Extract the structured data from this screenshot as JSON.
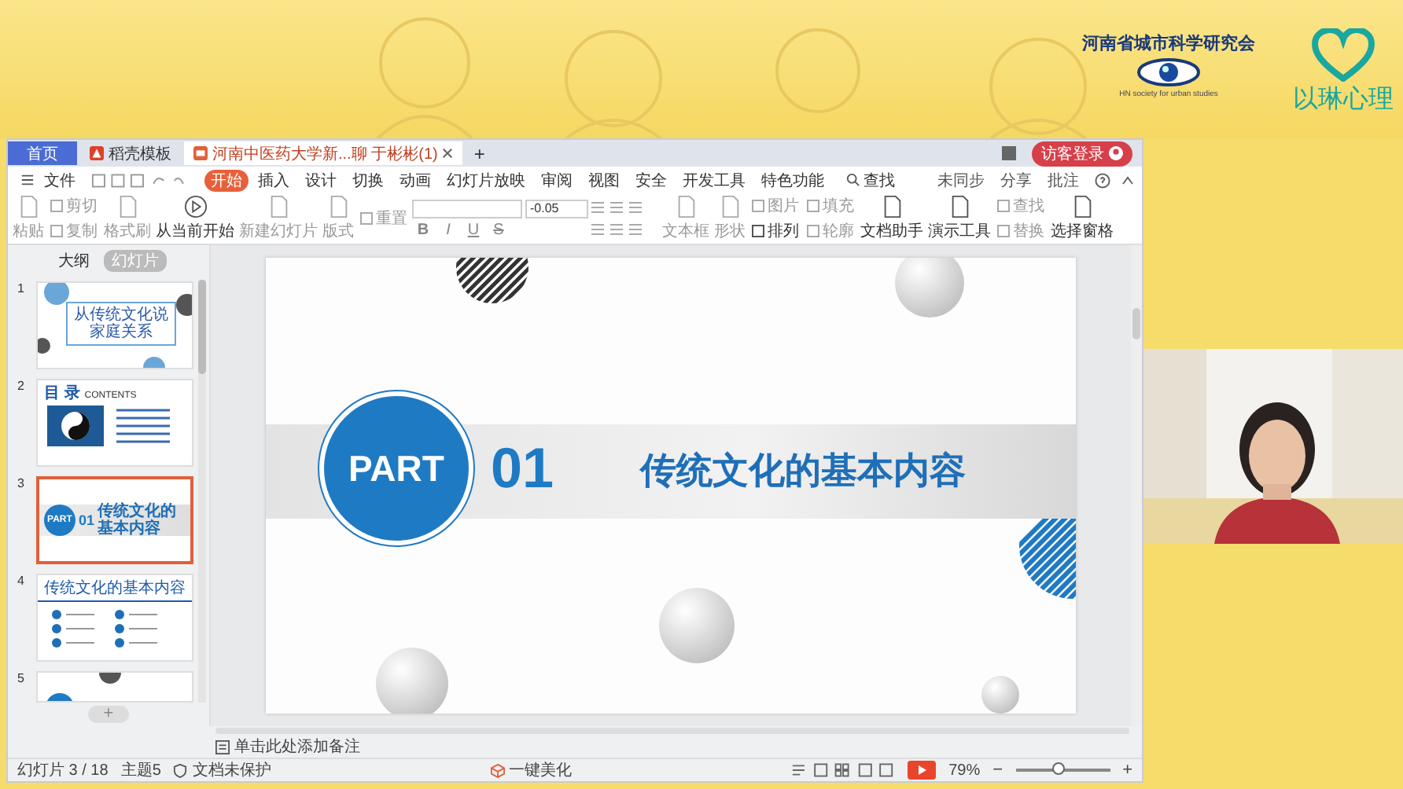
{
  "banner": {
    "org_name": "河南省城市科学研究会",
    "org_subtitle": "HN society for urban studies",
    "brand": "以琳心理"
  },
  "window": {
    "tabs": [
      {
        "label": "首页",
        "kind": "home",
        "selected": false
      },
      {
        "label": "稻壳模板",
        "kind": "template",
        "selected": false
      },
      {
        "label": "河南中医药大学新...聊 于彬彬(1)",
        "kind": "doc",
        "selected": true
      }
    ],
    "new_tab": "+",
    "login_button": "访客登录",
    "file_menu": "文件",
    "menu_tabs": [
      {
        "label": "开始",
        "selected": true
      },
      {
        "label": "插入",
        "selected": false
      },
      {
        "label": "设计",
        "selected": false
      },
      {
        "label": "切换",
        "selected": false
      },
      {
        "label": "动画",
        "selected": false
      },
      {
        "label": "幻灯片放映",
        "selected": false
      },
      {
        "label": "审阅",
        "selected": false
      },
      {
        "label": "视图",
        "selected": false
      },
      {
        "label": "安全",
        "selected": false
      },
      {
        "label": "开发工具",
        "selected": false
      },
      {
        "label": "特色功能",
        "selected": false
      }
    ],
    "search": "查找",
    "right_actions": [
      "未同步",
      "分享",
      "批注"
    ],
    "ribbon": [
      {
        "kind": "large",
        "label": "粘贴",
        "disabled": true
      },
      {
        "kind": "stack",
        "items": [
          {
            "label": "剪切",
            "disabled": true
          },
          {
            "label": "复制",
            "disabled": true
          }
        ]
      },
      {
        "kind": "large",
        "label": "格式刷",
        "disabled": true
      },
      {
        "kind": "play",
        "label": "从当前开始",
        "disabled": false
      },
      {
        "kind": "large",
        "label": "新建幻灯片",
        "disabled": true
      },
      {
        "kind": "large",
        "label": "版式",
        "disabled": true
      },
      {
        "kind": "stack",
        "items": [
          {
            "label": "重置",
            "disabled": true
          }
        ]
      },
      {
        "kind": "font",
        "size": "-0.05",
        "format_buttons": [
          "B",
          "I",
          "U",
          "S"
        ]
      },
      {
        "kind": "paragraph"
      },
      {
        "kind": "large",
        "label": "文本框",
        "disabled": true
      },
      {
        "kind": "large",
        "label": "形状",
        "disabled": true
      },
      {
        "kind": "stack",
        "items": [
          {
            "label": "图片",
            "disabled": true
          },
          {
            "label": "排列",
            "disabled": false
          }
        ]
      },
      {
        "kind": "stack",
        "items": [
          {
            "label": "填充",
            "disabled": true
          },
          {
            "label": "轮廓",
            "disabled": true
          }
        ]
      },
      {
        "kind": "large",
        "label": "文档助手",
        "disabled": false
      },
      {
        "kind": "large",
        "label": "演示工具",
        "disabled": false
      },
      {
        "kind": "stack",
        "items": [
          {
            "label": "查找",
            "disabled": true
          },
          {
            "label": "替换",
            "disabled": true
          }
        ]
      },
      {
        "kind": "large",
        "label": "选择窗格",
        "disabled": false
      }
    ],
    "panel_tabs": [
      {
        "label": "大纲",
        "selected": false
      },
      {
        "label": "幻灯片",
        "selected": true
      }
    ],
    "thumbnails": [
      {
        "number": "1",
        "kind": "title",
        "title": "从传统文化说家庭关系",
        "selected": false
      },
      {
        "number": "2",
        "kind": "contents",
        "title": "目 录",
        "subtitle": "CONTENTS",
        "selected": false
      },
      {
        "number": "3",
        "kind": "part",
        "badge": "PART",
        "index": "01",
        "title": "传统文化的基本内容",
        "selected": true
      },
      {
        "number": "4",
        "kind": "list",
        "title": "传统文化的基本内容",
        "selected": false
      },
      {
        "number": "5",
        "kind": "partial",
        "selected": false
      }
    ],
    "add_slide": "+",
    "slide": {
      "badge": "PART",
      "index": "01",
      "title": "传统文化的基本内容"
    },
    "notes_placeholder": "单击此处添加备注",
    "status": {
      "slide_count": "幻灯片 3 / 18",
      "theme": "主题5",
      "protection": "文档未保护",
      "beautify": "一键美化",
      "zoom": "79%",
      "zoom_minus": "−",
      "zoom_plus": "+",
      "level": 0.45
    }
  }
}
